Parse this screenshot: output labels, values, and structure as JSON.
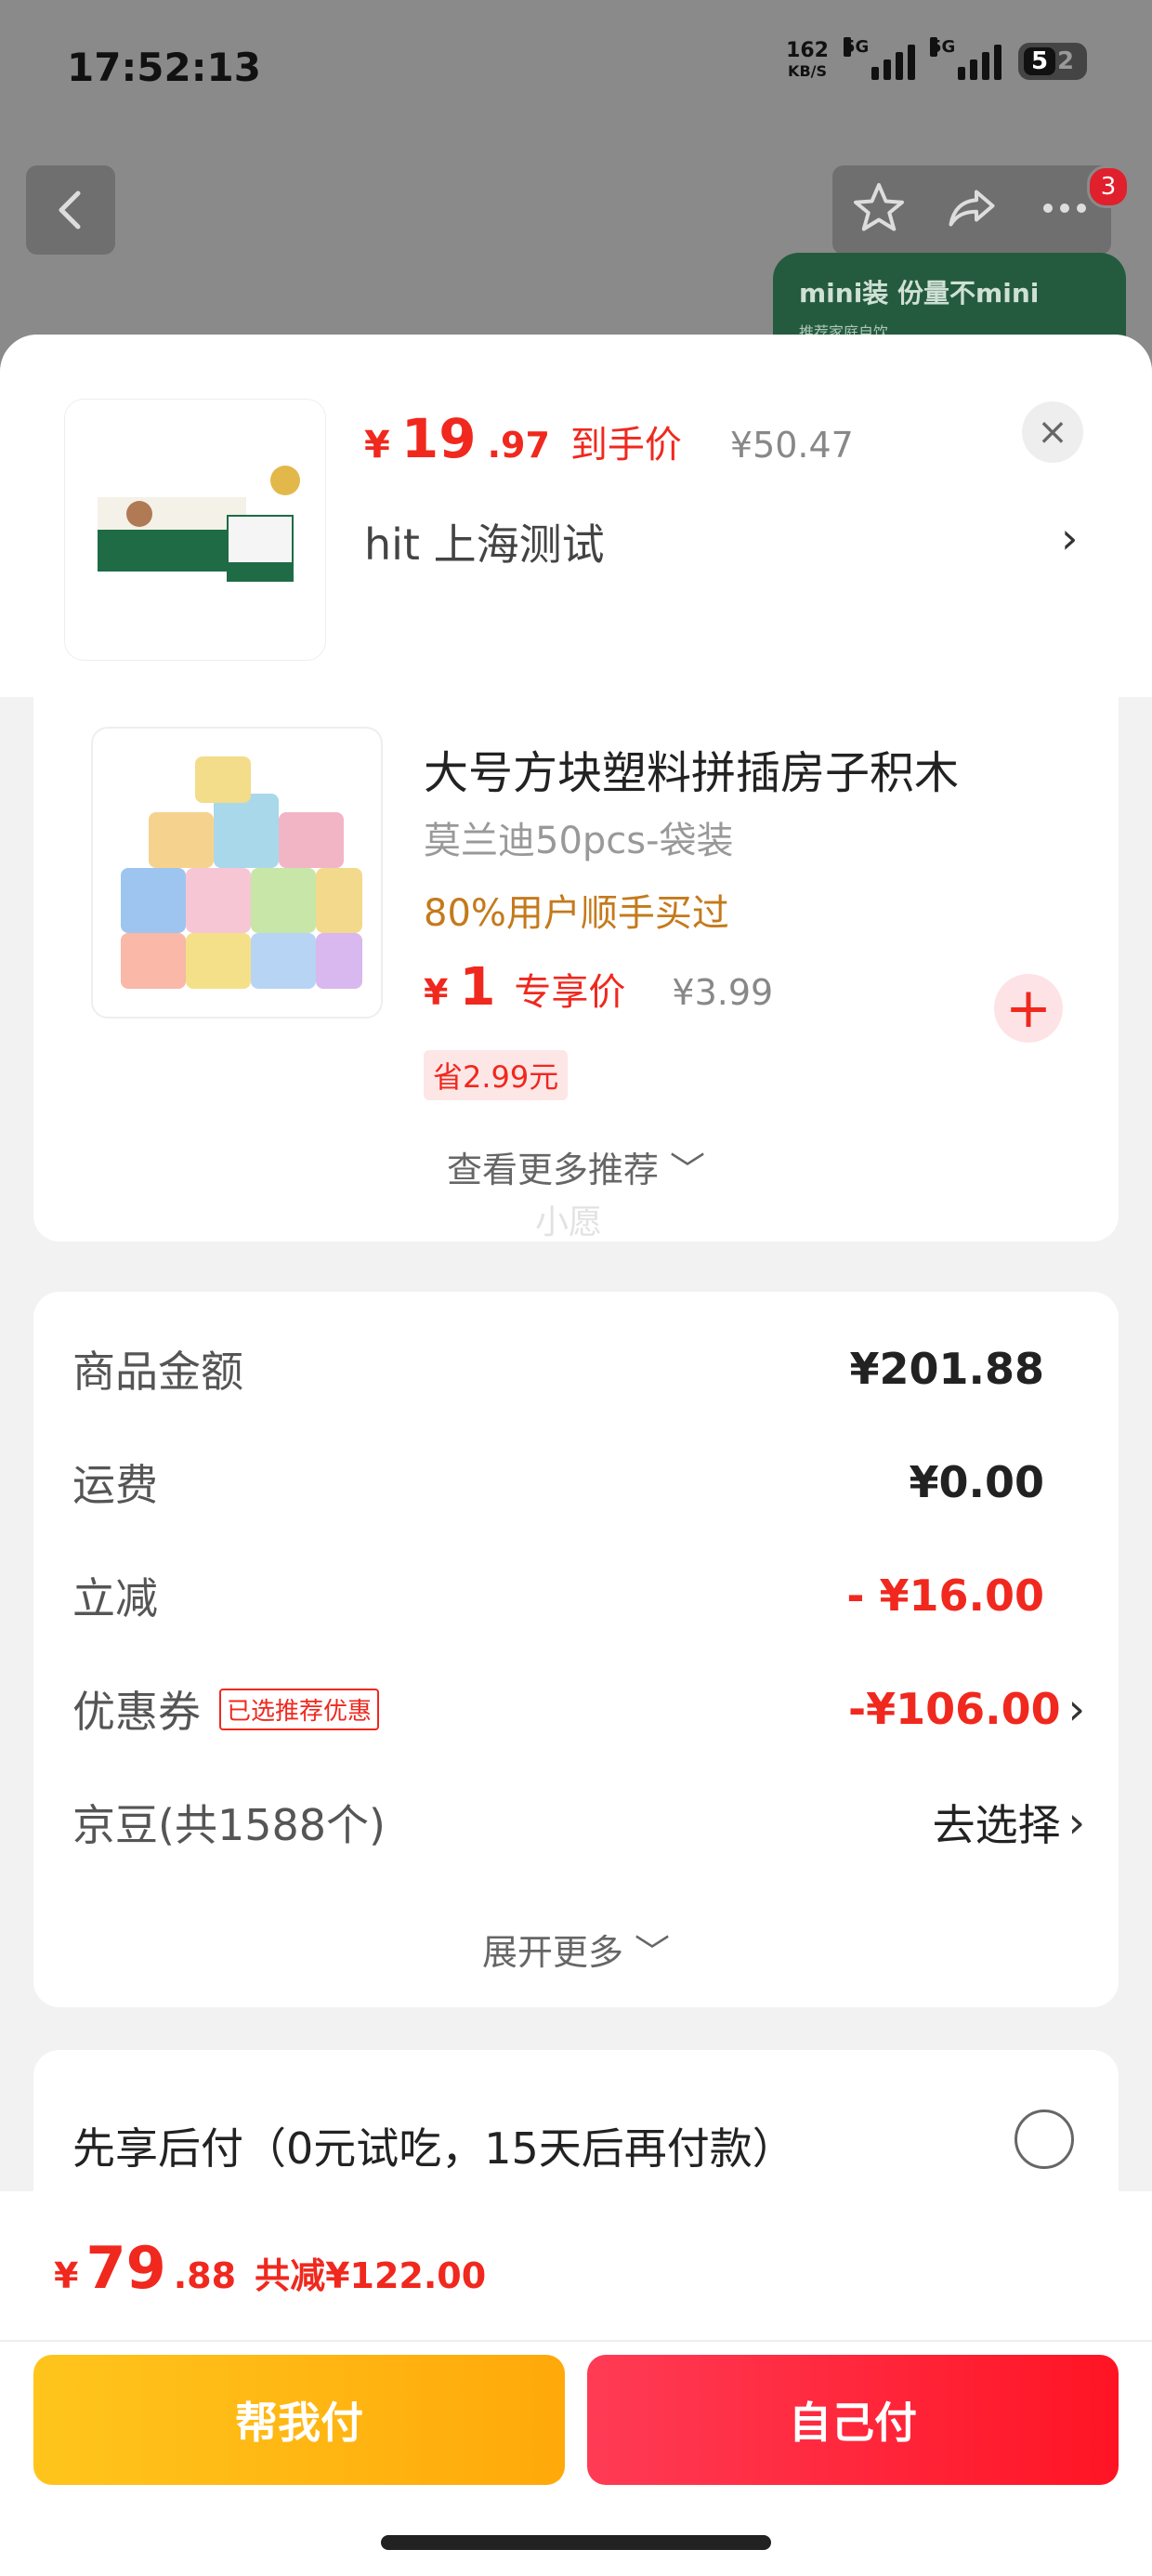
{
  "status_bar": {
    "time": "17:52:13",
    "net_speed_value": "162",
    "net_speed_unit": "KB/S",
    "signal1_label": "5G",
    "signal2_label": "5G",
    "battery": "52"
  },
  "top_nav": {
    "cart_badge": "3",
    "banner_line1": "mini装 份量不mini",
    "banner_line2": "推荐家庭自饮"
  },
  "product": {
    "price_yen": "¥",
    "price_int": "19",
    "price_dec": ".97",
    "price_tag": "到手价",
    "original_price": "¥50.47",
    "address": "hit  上海测试",
    "close_label": "×",
    "chevron": "›"
  },
  "recommendation": {
    "title": "大号方块塑料拼插房子积木",
    "spec": "莫兰迪50pcs-袋装",
    "bought_text": "80%用户顺手买过",
    "price_yen": "¥",
    "price_int": "1",
    "price_tag": "专享价",
    "original_price": "¥3.99",
    "save_text": "省2.99元",
    "add_label": "+",
    "more_label": "查看更多推荐 ﹀",
    "watermark": "小愿"
  },
  "summary": {
    "rows": [
      {
        "label": "商品金额",
        "value": "¥201.88"
      },
      {
        "label": "运费",
        "value": "¥0.00"
      },
      {
        "label": "立减",
        "value": "- ¥16.00"
      },
      {
        "label": "优惠券",
        "tag": "已选推荐优惠",
        "value": "-¥106.00",
        "chevron": "›"
      },
      {
        "label": "京豆(共1588个)",
        "value": "去选择",
        "chevron": "›"
      }
    ],
    "more_label": "展开更多 ﹀"
  },
  "pay_later": {
    "text": "先享后付（0元试吃，15天后再付款）"
  },
  "bottom_bar": {
    "price_yen": "¥",
    "price_int": "79",
    "price_dec": ".88",
    "save_text": "共减¥122.00",
    "help_pay_label": "帮我付",
    "self_pay_label": "自己付"
  },
  "colors": {
    "accent_red": "#f0281e",
    "help_btn": "#ffb814",
    "self_btn": "#ff2035"
  }
}
